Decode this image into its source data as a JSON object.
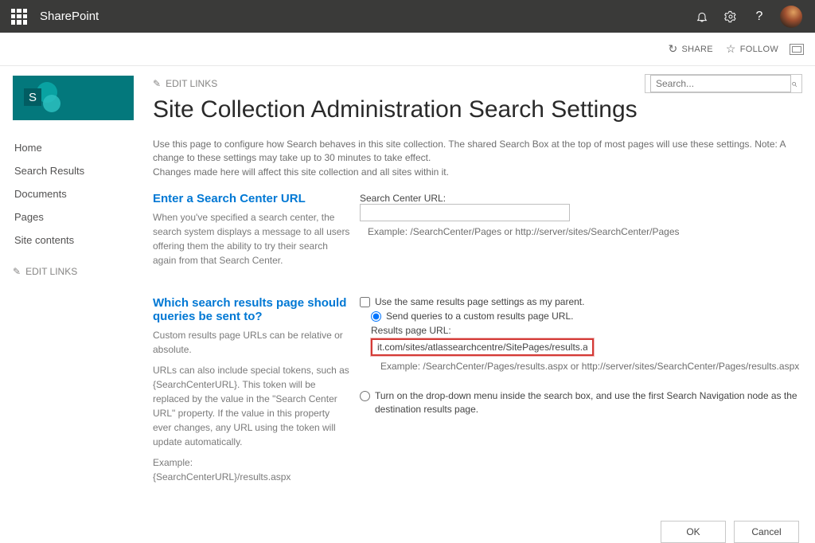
{
  "suite": {
    "title": "SharePoint"
  },
  "actions": {
    "share": "SHARE",
    "follow": "FOLLOW"
  },
  "logo": {
    "letter": "S"
  },
  "nav": {
    "items": [
      "Home",
      "Search Results",
      "Documents",
      "Pages",
      "Site contents"
    ],
    "edit_links": "EDIT LINKS"
  },
  "search": {
    "placeholder": "Search..."
  },
  "page": {
    "edit_links": "EDIT LINKS",
    "title": "Site Collection Administration Search Settings",
    "intro1": "Use this page to configure how Search behaves in this site collection. The shared Search Box at the top of most pages will use these settings. Note: A change to these settings may take up to 30 minutes to take effect.",
    "intro2": "Changes made here will affect this site collection and all sites within it."
  },
  "section1": {
    "title": "Enter a Search Center URL",
    "desc": "When you've specified a search center, the search system displays a message to all users offering them the ability to try their search again from that Search Center.",
    "label": "Search Center URL:",
    "value": "",
    "example": "Example: /SearchCenter/Pages or http://server/sites/SearchCenter/Pages"
  },
  "section2": {
    "title": "Which search results page should queries be sent to?",
    "desc1": "Custom results page URLs can be relative or absolute.",
    "desc2": "URLs can also include special tokens, such as {SearchCenterURL}. This token will be replaced by the value in the \"Search Center URL\" property. If the value in this property ever changes, any URL using the token will update automatically.",
    "desc3a": "Example:",
    "desc3b": "{SearchCenterURL}/results.aspx",
    "same_parent_label": "Use the same results page settings as my parent.",
    "send_custom_label": "Send queries to a custom results page URL.",
    "results_label": "Results page URL:",
    "results_value": "it.com/sites/atlassearchcentre/SitePages/results.aspx",
    "results_example": "Example: /SearchCenter/Pages/results.aspx or http://server/sites/SearchCenter/Pages/results.aspx",
    "dropdown_label": "Turn on the drop-down menu inside the search box, and use the first Search Navigation node as the destination results page."
  },
  "buttons": {
    "ok": "OK",
    "cancel": "Cancel"
  }
}
